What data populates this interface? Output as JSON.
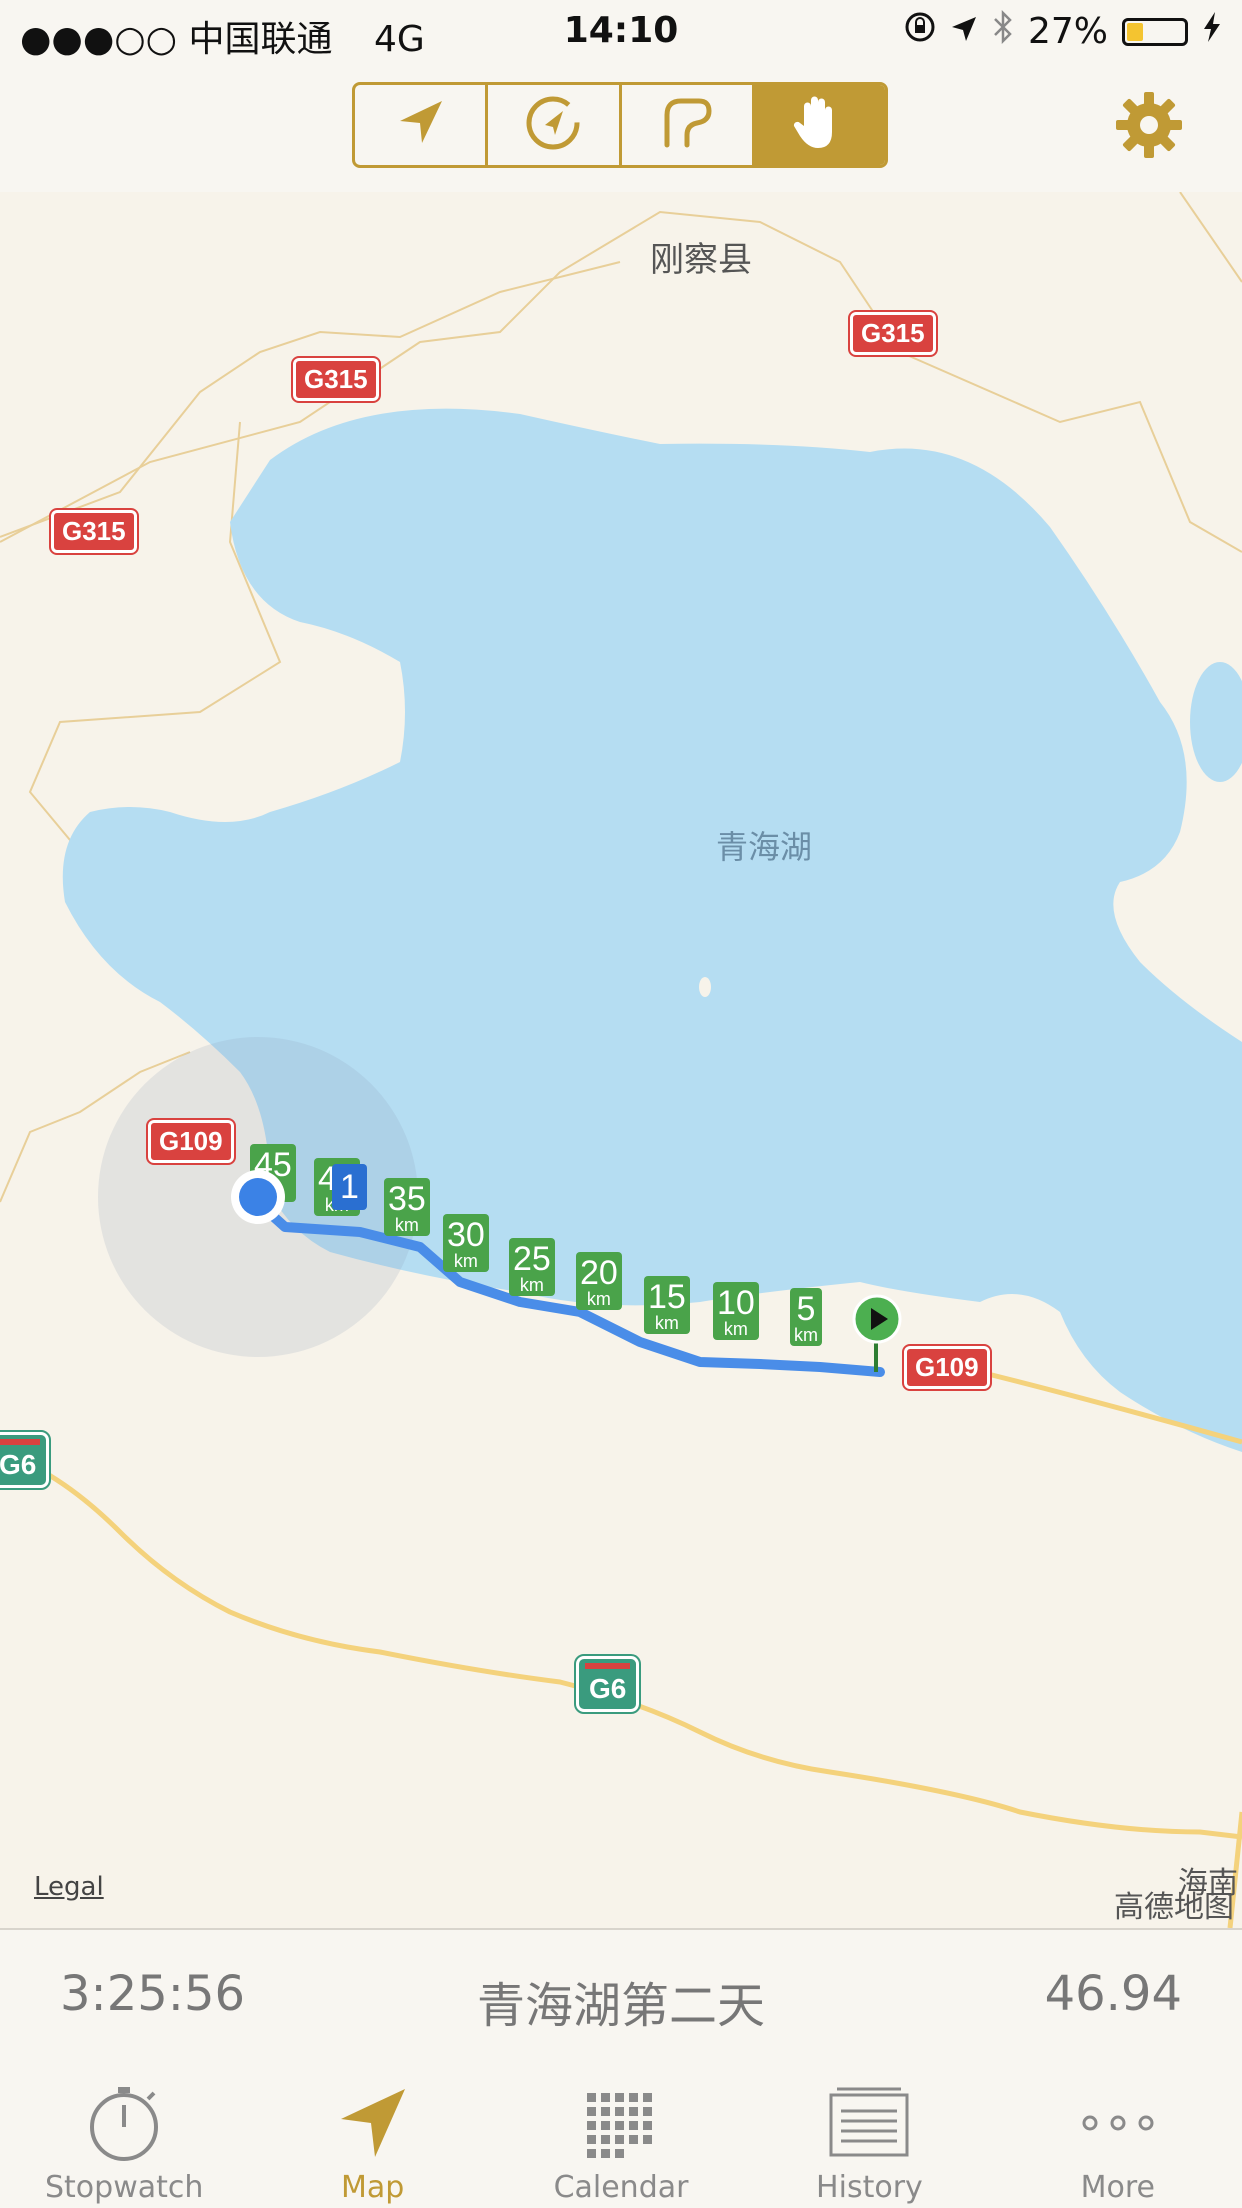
{
  "status_bar": {
    "carrier": "●●●○○ 中国联通",
    "network": "4G",
    "time": "14:10",
    "battery": "27%"
  },
  "toolbar": {
    "modes": [
      "navigate",
      "auto-rotate",
      "route",
      "hand"
    ],
    "active_mode": "hand"
  },
  "map": {
    "labels": {
      "county": "刚察县",
      "lake": "青海湖"
    },
    "road_shields": {
      "g315": "G315",
      "g109": "G109",
      "g6": "G6"
    },
    "km_markers": [
      {
        "n": "45",
        "u": "km"
      },
      {
        "n": "40",
        "u": "km"
      },
      {
        "n": "35",
        "u": "km"
      },
      {
        "n": "30",
        "u": "km"
      },
      {
        "n": "25",
        "u": "km"
      },
      {
        "n": "20",
        "u": "km"
      },
      {
        "n": "15",
        "u": "km"
      },
      {
        "n": "10",
        "u": "km"
      },
      {
        "n": "5",
        "u": "km"
      }
    ],
    "lap_marker": "1",
    "legal": "Legal",
    "attribution": "高德地图",
    "corner_label": "海南"
  },
  "summary": {
    "duration": "3:25:56",
    "name": "青海湖第二天",
    "distance": "46.94"
  },
  "tabs": [
    {
      "label": "Stopwatch",
      "icon": "stopwatch-icon"
    },
    {
      "label": "Map",
      "icon": "map-arrow-icon"
    },
    {
      "label": "Calendar",
      "icon": "calendar-icon"
    },
    {
      "label": "History",
      "icon": "history-icon"
    },
    {
      "label": "More",
      "icon": "more-icon"
    }
  ],
  "active_tab": "Map",
  "colors": {
    "accent": "#c09a35",
    "route": "#4a8de8",
    "lake": "#b5ddf2",
    "marker_green": "#4aa34a"
  }
}
